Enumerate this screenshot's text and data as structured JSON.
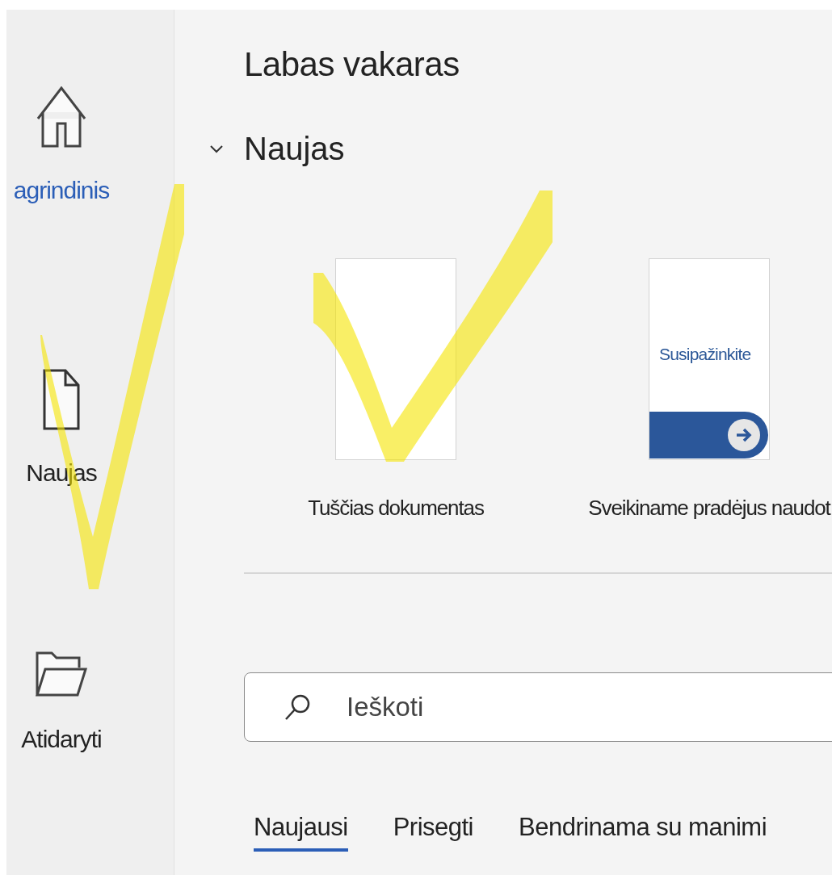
{
  "sidebar": {
    "items": [
      {
        "kind": "home",
        "label": "agrindinis",
        "selected": true
      },
      {
        "kind": "new",
        "label": "Naujas",
        "selected": false
      },
      {
        "kind": "open",
        "label": "Atidaryti",
        "selected": false
      }
    ]
  },
  "greeting": "Labas vakaras",
  "new_section": {
    "title": "Naujas",
    "expanded": true,
    "templates": [
      {
        "kind": "blank",
        "label": "Tuščias dokumentas"
      },
      {
        "kind": "tour",
        "label": "Sveikiname pradėjus naudot",
        "thumbnail_text": "Susipažinkite"
      }
    ]
  },
  "search": {
    "placeholder": "Ieškoti"
  },
  "tabs": [
    {
      "label": "Naujausi",
      "selected": true
    },
    {
      "label": "Prisegti",
      "selected": false
    },
    {
      "label": "Bendrinama su manimi",
      "selected": false
    }
  ],
  "annotations": [
    {
      "kind": "checkmark"
    },
    {
      "kind": "checkmark"
    }
  ]
}
